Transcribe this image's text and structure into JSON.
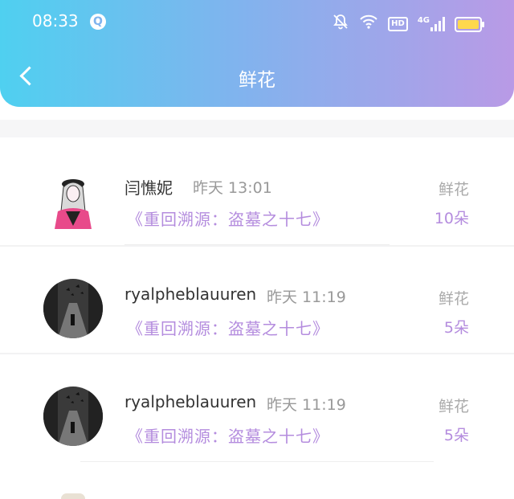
{
  "status_bar": {
    "time": "08:33",
    "hd_label": "HD",
    "network_label": "4G"
  },
  "header": {
    "title": "鲜花"
  },
  "rows": [
    {
      "name": "闫憔妮",
      "time": "昨天 13:01",
      "book": "《重回溯源：盗墓之十七》",
      "flower_label": "鲜花",
      "count": "10朵"
    },
    {
      "name": "ryalpheblauuren",
      "time": "昨天 11:19",
      "book": "《重回溯源：盗墓之十七》",
      "flower_label": "鲜花",
      "count": "5朵"
    },
    {
      "name": "ryalpheblauuren",
      "time": "昨天 11:19",
      "book": "《重回溯源：盗墓之十七》",
      "flower_label": "鲜花",
      "count": "5朵"
    }
  ]
}
